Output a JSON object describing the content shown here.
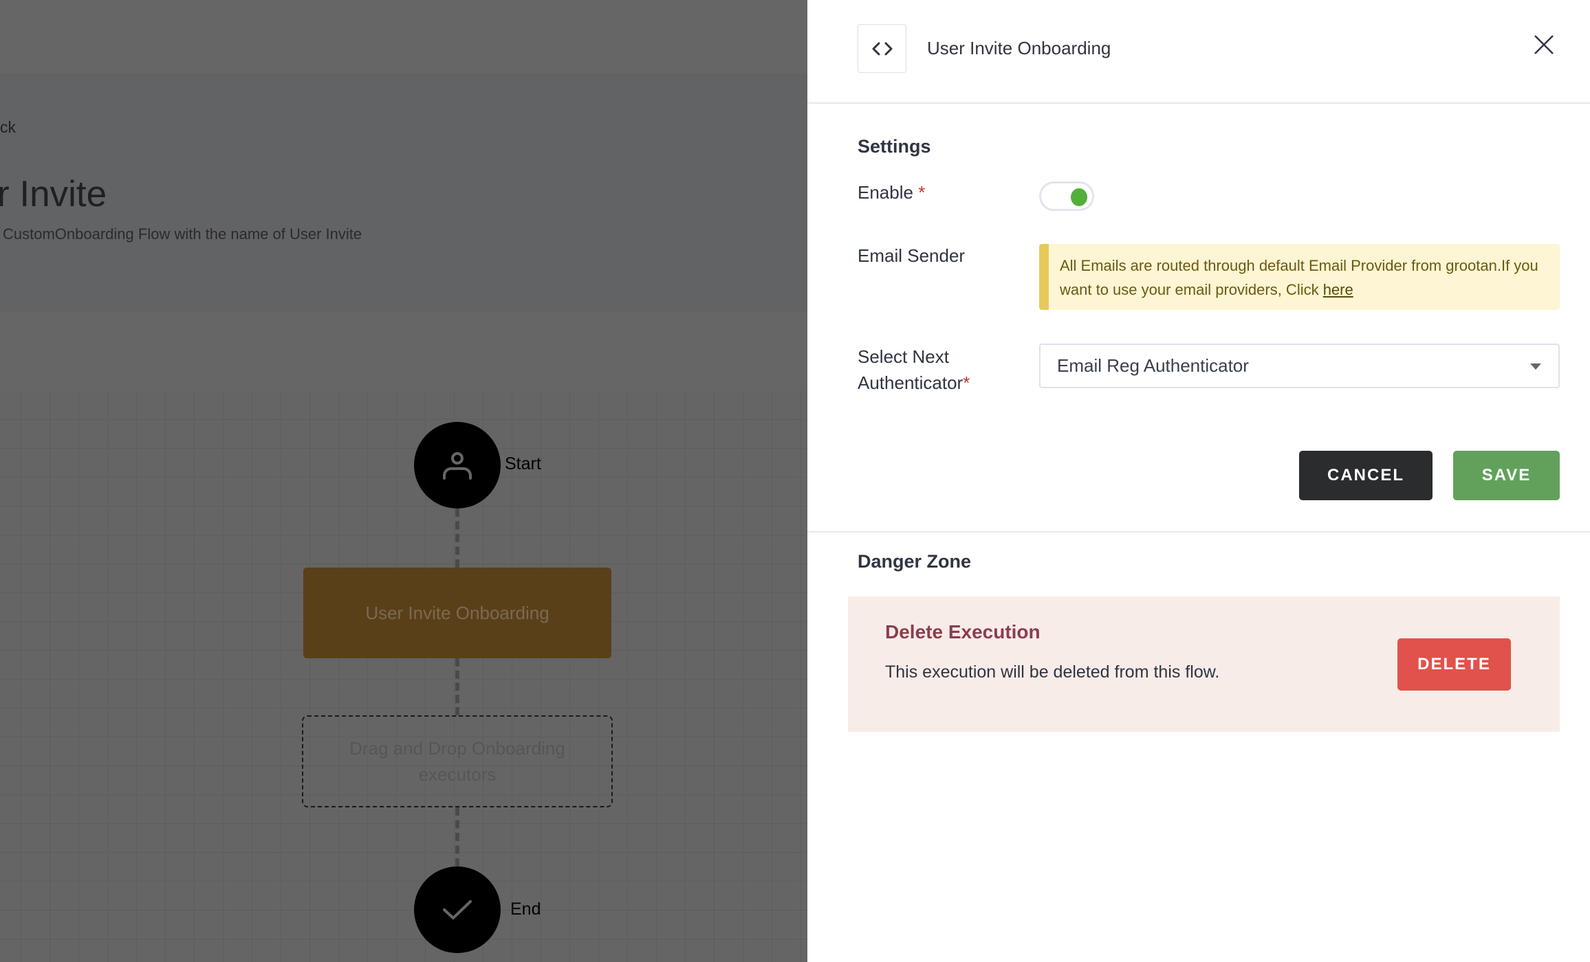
{
  "background": {
    "back_link": "ck",
    "title": "r Invite",
    "description": "CustomOnboarding Flow with the name of User Invite",
    "flow": {
      "start_label": "Start",
      "start_icon": "user-icon",
      "node_label": "User Invite Onboarding",
      "dropzone_label": "Drag and Drop Onboarding executors",
      "end_label": "End",
      "end_icon": "check-icon",
      "node_color": "#5a4019"
    }
  },
  "panel": {
    "header": {
      "icon": "code-icon",
      "title": "User Invite Onboarding",
      "close_icon": "close-icon"
    },
    "settings": {
      "heading": "Settings",
      "enable_label": "Enable",
      "required_mark": "*",
      "enable_on": true,
      "email_sender_label": "Email Sender",
      "alert_text": "All Emails are routed through default Email Provider from grootan.If you want to use your email providers, Click ",
      "alert_link": "here",
      "next_auth_label_1": "Select Next",
      "next_auth_label_2": "Authenticator",
      "next_auth_value": "Email Reg Authenticator",
      "cancel_label": "CANCEL",
      "save_label": "SAVE"
    },
    "danger": {
      "heading": "Danger Zone",
      "title": "Delete Execution",
      "description": "This execution will be deleted from this flow.",
      "delete_label": "DELETE"
    },
    "colors": {
      "save": "#62a15c",
      "cancel": "#2b2c2e",
      "delete": "#e0524b",
      "toggle": "#52b038",
      "alert_bg": "#fdf5d3",
      "alert_border": "#e7c95a",
      "danger_bg": "#f8ece9"
    }
  }
}
